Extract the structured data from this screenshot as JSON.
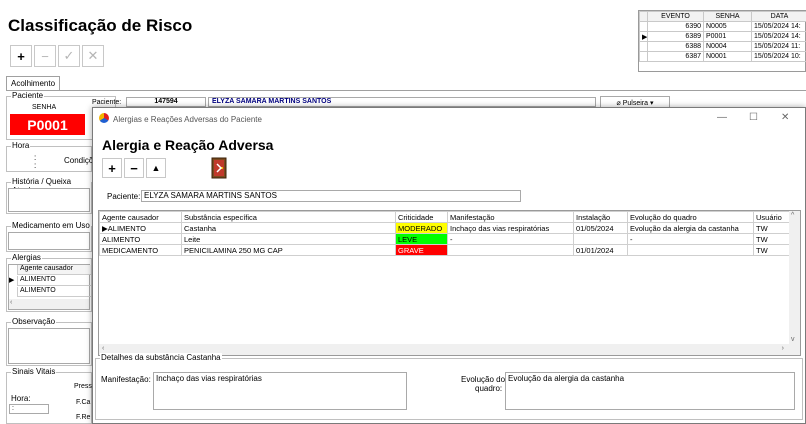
{
  "page": {
    "title": "Classificação de Risco"
  },
  "toolbar": {
    "add": "+",
    "remove": "−",
    "confirm": "✓",
    "cancel": "✕"
  },
  "queue": {
    "headers": [
      "EVENTO",
      "SENHA",
      "DATA"
    ],
    "rows": [
      [
        "6390",
        "N0005",
        "15/05/2024 14:"
      ],
      [
        "6389",
        "P0001",
        "15/05/2024 14:"
      ],
      [
        "6388",
        "N0004",
        "15/05/2024 11:"
      ],
      [
        "6387",
        "N0001",
        "15/05/2024 10:"
      ]
    ]
  },
  "tabs": {
    "acolhimento": "Acolhimento"
  },
  "paciente_group": {
    "label": "Paciente",
    "senha_label": "SENHA",
    "senha_value": "P0001",
    "paciente_label": "Paciente:",
    "paciente_id": "147594",
    "paciente_nome": "ELYZA SAMARA MARTINS SANTOS",
    "pulseira": "Pulseira"
  },
  "hora_group": {
    "label": "Hora",
    "value": ":",
    "condicoes": "Condiçõ"
  },
  "historia_group": {
    "label": "História / Queixa Atual"
  },
  "medicamento_group": {
    "label": "Medicamento em Uso"
  },
  "alergias_group": {
    "label": "Alergias",
    "header": "Agente causador",
    "rows": [
      "ALIMENTO",
      "ALIMENTO"
    ]
  },
  "observacao_group": {
    "label": "Observação"
  },
  "sinais_group": {
    "label": "Sinais Vitais",
    "hora_label": "Hora:",
    "hora_value": ":",
    "press": "Press",
    "fc": "F.Ca",
    "fr": "F.Re"
  },
  "modal": {
    "title": "Alergias e Reações Adversas do Paciente",
    "heading": "Alergia e Reação Adversa",
    "controls": {
      "minimize": "—",
      "maximize": "☐",
      "close": "✕"
    },
    "paciente_label": "Paciente:",
    "paciente_value": "ELYZA SAMARA MARTINS SANTOS",
    "grid": {
      "headers": [
        "Agente causador",
        "Substância específica",
        "Criticidade",
        "Manifestação",
        "Instalação",
        "Evolução do quadro",
        "Usuário"
      ],
      "rows": [
        [
          "ALIMENTO",
          "Castanha",
          "MODERADO",
          "Inchaço das vias respiratórias",
          "01/05/2024",
          "Evolução da alergia da castanha",
          "TW"
        ],
        [
          "ALIMENTO",
          "Leite",
          "LEVE",
          "-",
          "",
          "-",
          "TW"
        ],
        [
          "MEDICAMENTO",
          "PENICILAMINA 250 MG CAP",
          "GRAVE",
          "",
          "01/01/2024",
          "",
          "TW"
        ]
      ]
    },
    "details": {
      "label": "Detalhes da substância Castanha",
      "manifestacao_label": "Manifestação:",
      "manifestacao_value": "Inchaço das vias respiratórias",
      "evolucao_label_1": "Evolução do",
      "evolucao_label_2": "quadro:",
      "evolucao_value": "Evolução da alergia da castanha"
    }
  },
  "colors": {
    "senha_bg": "#ff0000",
    "moderado": "#ffff00",
    "leve": "#00ff00",
    "grave": "#ff0000",
    "patient_name": "#000080"
  }
}
